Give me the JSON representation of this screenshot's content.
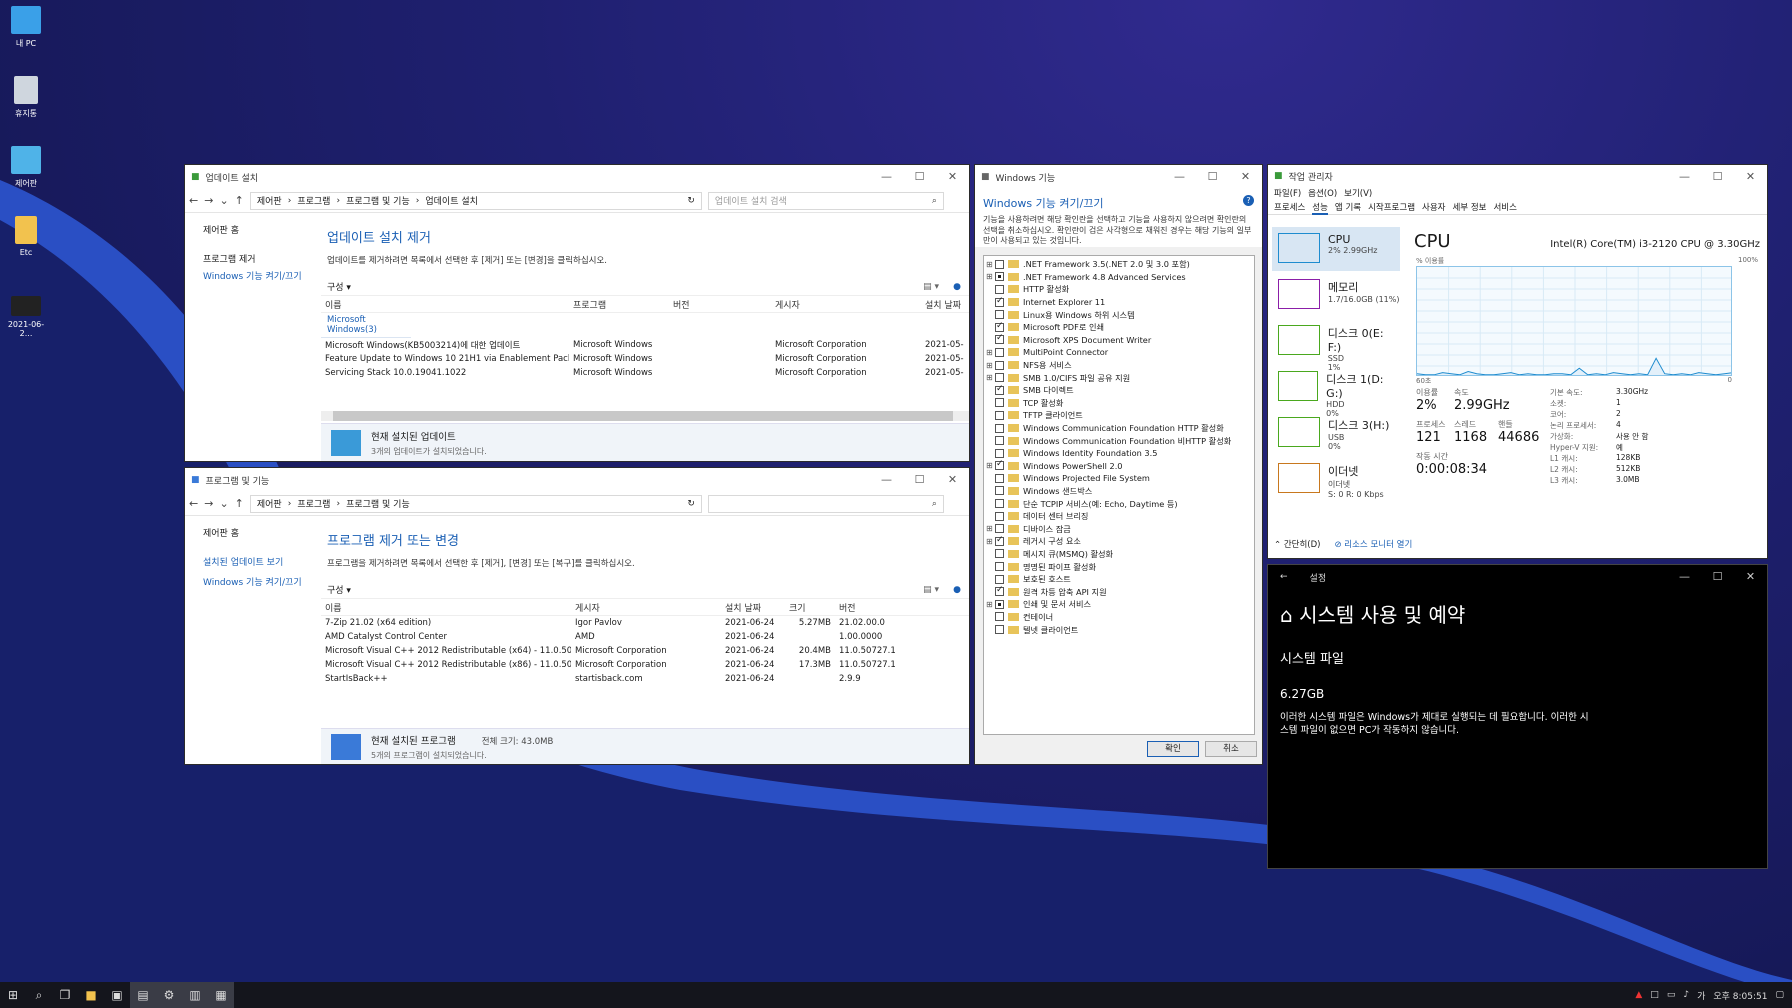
{
  "desktop": {
    "icons": [
      {
        "label": "내 PC",
        "icon": "monitor-icon"
      },
      {
        "label": "휴지통",
        "icon": "recycle-bin-icon"
      },
      {
        "label": "제어판",
        "icon": "control-panel-icon"
      },
      {
        "label": "Etc",
        "icon": "folder-icon"
      },
      {
        "label": "2021-06-2...",
        "icon": "screenshot-file-icon"
      }
    ]
  },
  "updates": {
    "title": "업데이트 설치",
    "crumbs": [
      "제어판",
      "프로그램",
      "프로그램 및 기능",
      "업데이트 설치"
    ],
    "search_placeholder": "업데이트 설치 검색",
    "left_links": [
      "제어판 홈",
      "프로그램 제거",
      "Windows 기능 켜기/끄기"
    ],
    "heading": "업데이트 설치 제거",
    "desc": "업데이트를 제거하려면 목록에서 선택한 후 [제거] 또는 [변경]을 클릭하십시오.",
    "organize": "구성 ▾",
    "columns": [
      "이름",
      "프로그램",
      "버전",
      "게시자",
      "설치 날짜"
    ],
    "group": "Microsoft Windows(3)",
    "rows": [
      [
        "Microsoft Windows(KB5003214)에 대한 업데이트",
        "Microsoft Windows",
        "",
        "Microsoft Corporation",
        "2021-05-"
      ],
      [
        "Feature Update to Windows 10 21H1 via Enablement Pack...",
        "Microsoft Windows",
        "",
        "Microsoft Corporation",
        "2021-05-"
      ],
      [
        "Servicing Stack 10.0.19041.1022",
        "Microsoft Windows",
        "",
        "Microsoft Corporation",
        "2021-05-"
      ]
    ],
    "status_title": "현재 설치된 업데이트",
    "status_sub": "3개의 업데이트가 설치되었습니다."
  },
  "programs": {
    "title": "프로그램 및 기능",
    "crumbs": [
      "제어판",
      "프로그램",
      "프로그램 및 기능"
    ],
    "left_links": [
      "제어판 홈",
      "설치된 업데이트 보기",
      "Windows 기능 켜기/끄기"
    ],
    "heading": "프로그램 제거 또는 변경",
    "desc": "프로그램을 제거하려면 목록에서 선택한 후 [제거], [변경] 또는 [복구]를 클릭하십시오.",
    "organize": "구성 ▾",
    "columns": [
      "이름",
      "게시자",
      "설치 날짜",
      "크기",
      "버전"
    ],
    "rows": [
      [
        "7-Zip 21.02 (x64 edition)",
        "Igor Pavlov",
        "2021-06-24",
        "5.27MB",
        "21.02.00.0"
      ],
      [
        "AMD Catalyst Control Center",
        "AMD",
        "2021-06-24",
        "",
        "1.00.0000"
      ],
      [
        "Microsoft Visual C++ 2012 Redistributable (x64) - 11.0.50...",
        "Microsoft Corporation",
        "2021-06-24",
        "20.4MB",
        "11.0.50727.1"
      ],
      [
        "Microsoft Visual C++ 2012 Redistributable (x86) - 11.0.50...",
        "Microsoft Corporation",
        "2021-06-24",
        "17.3MB",
        "11.0.50727.1"
      ],
      [
        "StartIsBack++",
        "startisback.com",
        "2021-06-24",
        "",
        "2.9.9"
      ]
    ],
    "status_title": "현재 설치된 프로그램",
    "status_total": "전체 크기:   43.0MB",
    "status_sub": "5개의 프로그램이 설치되었습니다."
  },
  "features": {
    "title": "Windows 기능",
    "heading": "Windows 기능 켜기/끄기",
    "desc": "기능을 사용하려면 해당 확인란을 선택하고 기능을 사용하지 않으려면 확인란의 선택을 취소하십시오. 확인란이 검은 사각형으로 채워진 경우는 해당 기능의 일부만이 사용되고 있는 것입니다.",
    "items": [
      {
        "l": ".NET Framework 3.5(.NET 2.0 및 3.0 포함)",
        "s": "off",
        "e": true
      },
      {
        "l": ".NET Framework 4.8 Advanced Services",
        "s": "part",
        "e": true
      },
      {
        "l": "HTTP 활성화",
        "s": "off",
        "e": false
      },
      {
        "l": "Internet Explorer 11",
        "s": "on",
        "e": false
      },
      {
        "l": "Linux용 Windows 하위 시스템",
        "s": "off",
        "e": false
      },
      {
        "l": "Microsoft PDF로 인쇄",
        "s": "on",
        "e": false
      },
      {
        "l": "Microsoft XPS Document Writer",
        "s": "on",
        "e": false
      },
      {
        "l": "MultiPoint Connector",
        "s": "off",
        "e": true
      },
      {
        "l": "NFS용 서비스",
        "s": "off",
        "e": true
      },
      {
        "l": "SMB 1.0/CIFS 파일 공유 지원",
        "s": "off",
        "e": true
      },
      {
        "l": "SMB 다이렉트",
        "s": "on",
        "e": false
      },
      {
        "l": "TCP 활성화",
        "s": "off",
        "e": false
      },
      {
        "l": "TFTP 클라이언트",
        "s": "off",
        "e": false
      },
      {
        "l": "Windows Communication Foundation HTTP 활성화",
        "s": "off",
        "e": false
      },
      {
        "l": "Windows Communication Foundation 비HTTP 활성화",
        "s": "off",
        "e": false
      },
      {
        "l": "Windows Identity Foundation 3.5",
        "s": "off",
        "e": false
      },
      {
        "l": "Windows PowerShell 2.0",
        "s": "on",
        "e": true
      },
      {
        "l": "Windows Projected File System",
        "s": "off",
        "e": false
      },
      {
        "l": "Windows 샌드박스",
        "s": "off",
        "e": false
      },
      {
        "l": "단순 TCPIP 서비스(예: Echo, Daytime 등)",
        "s": "off",
        "e": false
      },
      {
        "l": "데이터 센터 브리징",
        "s": "off",
        "e": false
      },
      {
        "l": "디바이스 잠금",
        "s": "off",
        "e": true
      },
      {
        "l": "레거시 구성 요소",
        "s": "on",
        "e": true
      },
      {
        "l": "메시지 큐(MSMQ) 활성화",
        "s": "off",
        "e": false
      },
      {
        "l": "명명된 파이프 활성화",
        "s": "off",
        "e": false
      },
      {
        "l": "보호된 호스트",
        "s": "off",
        "e": false
      },
      {
        "l": "원격 차등 압축 API 지원",
        "s": "on",
        "e": false
      },
      {
        "l": "인쇄 및 문서 서비스",
        "s": "part",
        "e": true
      },
      {
        "l": "컨테이너",
        "s": "off",
        "e": false
      },
      {
        "l": "텔넷 클라이언트",
        "s": "off",
        "e": false
      }
    ],
    "ok": "확인",
    "cancel": "취소"
  },
  "taskmgr": {
    "title": "작업 관리자",
    "menu": [
      "파일(F)",
      "옵션(O)",
      "보기(V)"
    ],
    "tabs": [
      "프로세스",
      "성능",
      "앱 기록",
      "시작프로그램",
      "사용자",
      "세부 정보",
      "서비스"
    ],
    "side": [
      {
        "t1": "CPU",
        "t2": "2% 2.99GHz",
        "t3": "",
        "color": "#1e8ccf"
      },
      {
        "t1": "메모리",
        "t2": "1.7/16.0GB (11%)",
        "t3": "",
        "color": "#8b1ea8"
      },
      {
        "t1": "디스크 0(E: F:)",
        "t2": "SSD",
        "t3": "1%",
        "color": "#4aa81e"
      },
      {
        "t1": "디스크 1(D: G:)",
        "t2": "HDD",
        "t3": "0%",
        "color": "#4aa81e"
      },
      {
        "t1": "디스크 3(H:)",
        "t2": "USB",
        "t3": "0%",
        "color": "#4aa81e"
      },
      {
        "t1": "이더넷",
        "t2": "이더넷",
        "t3": "S: 0  R: 0 Kbps",
        "color": "#c8781e"
      }
    ],
    "cpu_title": "CPU",
    "cpu_name": "Intel(R) Core(TM) i3-2120 CPU @ 3.30GHz",
    "util_label": "% 이용률",
    "max_label": "100%",
    "time_label": "60초",
    "min_label": "0",
    "graph": [
      3,
      2,
      2,
      4,
      3,
      2,
      5,
      3,
      2,
      2,
      3,
      4,
      2,
      3,
      2,
      2,
      3,
      3,
      2,
      8,
      2,
      3,
      2,
      4,
      3,
      2,
      3,
      2,
      17,
      3,
      2,
      3,
      2,
      4,
      3,
      2,
      3,
      4
    ],
    "stats": {
      "util_l": "이용률",
      "util": "2%",
      "speed_l": "속도",
      "speed": "2.99GHz",
      "proc_l": "프로세스",
      "proc": "121",
      "thread_l": "스레드",
      "thread": "1168",
      "handle_l": "핸들",
      "handle": "44686",
      "uptime_l": "작동 시간",
      "uptime": "0:00:08:34"
    },
    "right_stats": [
      [
        "기본 속도:",
        "3.30GHz"
      ],
      [
        "소켓:",
        "1"
      ],
      [
        "코어:",
        "2"
      ],
      [
        "논리 프로세서:",
        "4"
      ],
      [
        "가상화:",
        "사용 안 함"
      ],
      [
        "Hyper-V 지원:",
        "예"
      ],
      [
        "L1 캐시:",
        "128KB"
      ],
      [
        "L2 캐시:",
        "512KB"
      ],
      [
        "L3 캐시:",
        "3.0MB"
      ]
    ],
    "footer_less": "간단히(D)",
    "footer_monitor": "리소스 모니터 열기"
  },
  "settings": {
    "title": "설정",
    "heading": "시스템 사용 및 예약",
    "section": "시스템 파일",
    "size": "6.27GB",
    "desc": "이러한 시스템 파일은 Windows가 제대로 실행되는 데 필요합니다. 이러한 시스템 파일이 없으면 PC가 작동하지 않습니다."
  },
  "taskbar": {
    "time": "오후 8:05:51"
  }
}
